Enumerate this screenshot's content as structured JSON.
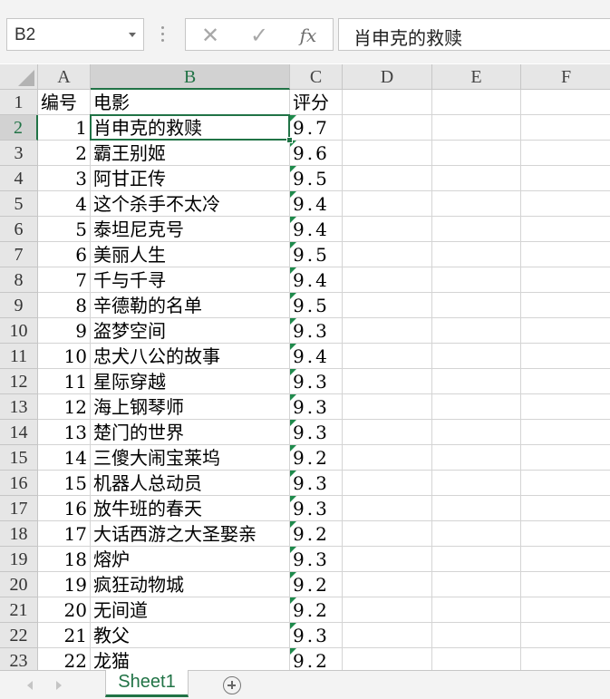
{
  "name_box": {
    "value": "B2"
  },
  "formula_bar": {
    "cancel_glyph": "✕",
    "enter_glyph": "✓",
    "fx_label": "fx",
    "content": "肖申克的救赎"
  },
  "columns": [
    "A",
    "B",
    "C",
    "D",
    "E",
    "F"
  ],
  "selected_col": "B",
  "selected_row": 2,
  "header_row": {
    "a": "编号",
    "b": "电影",
    "c": "评分"
  },
  "rows": [
    {
      "row": 2,
      "a": "1",
      "b": "肖申克的救赎",
      "c": "9.7"
    },
    {
      "row": 3,
      "a": "2",
      "b": "霸王别姬",
      "c": "9.6"
    },
    {
      "row": 4,
      "a": "3",
      "b": "阿甘正传",
      "c": "9.5"
    },
    {
      "row": 5,
      "a": "4",
      "b": "这个杀手不太冷",
      "c": "9.4"
    },
    {
      "row": 6,
      "a": "5",
      "b": "泰坦尼克号",
      "c": "9.4"
    },
    {
      "row": 7,
      "a": "6",
      "b": "美丽人生",
      "c": "9.5"
    },
    {
      "row": 8,
      "a": "7",
      "b": "千与千寻",
      "c": "9.4"
    },
    {
      "row": 9,
      "a": "8",
      "b": "辛德勒的名单",
      "c": "9.5"
    },
    {
      "row": 10,
      "a": "9",
      "b": "盗梦空间",
      "c": "9.3"
    },
    {
      "row": 11,
      "a": "10",
      "b": "忠犬八公的故事",
      "c": "9.4"
    },
    {
      "row": 12,
      "a": "11",
      "b": "星际穿越",
      "c": "9.3"
    },
    {
      "row": 13,
      "a": "12",
      "b": "海上钢琴师",
      "c": "9.3"
    },
    {
      "row": 14,
      "a": "13",
      "b": "楚门的世界",
      "c": "9.3"
    },
    {
      "row": 15,
      "a": "14",
      "b": "三傻大闹宝莱坞",
      "c": "9.2"
    },
    {
      "row": 16,
      "a": "15",
      "b": "机器人总动员",
      "c": "9.3"
    },
    {
      "row": 17,
      "a": "16",
      "b": "放牛班的春天",
      "c": "9.3"
    },
    {
      "row": 18,
      "a": "17",
      "b": "大话西游之大圣娶亲",
      "c": "9.2"
    },
    {
      "row": 19,
      "a": "18",
      "b": "熔炉",
      "c": "9.3"
    },
    {
      "row": 20,
      "a": "19",
      "b": "疯狂动物城",
      "c": "9.2"
    },
    {
      "row": 21,
      "a": "20",
      "b": "无间道",
      "c": "9.2"
    },
    {
      "row": 22,
      "a": "21",
      "b": "教父",
      "c": "9.3"
    },
    {
      "row": 23,
      "a": "22",
      "b": "龙猫",
      "c": "9.2"
    }
  ],
  "sheet_tabs": [
    {
      "label": "Sheet1",
      "active": true
    }
  ],
  "colors": {
    "accent": "#217346",
    "text_number_indicator": "#1f8a4c"
  }
}
